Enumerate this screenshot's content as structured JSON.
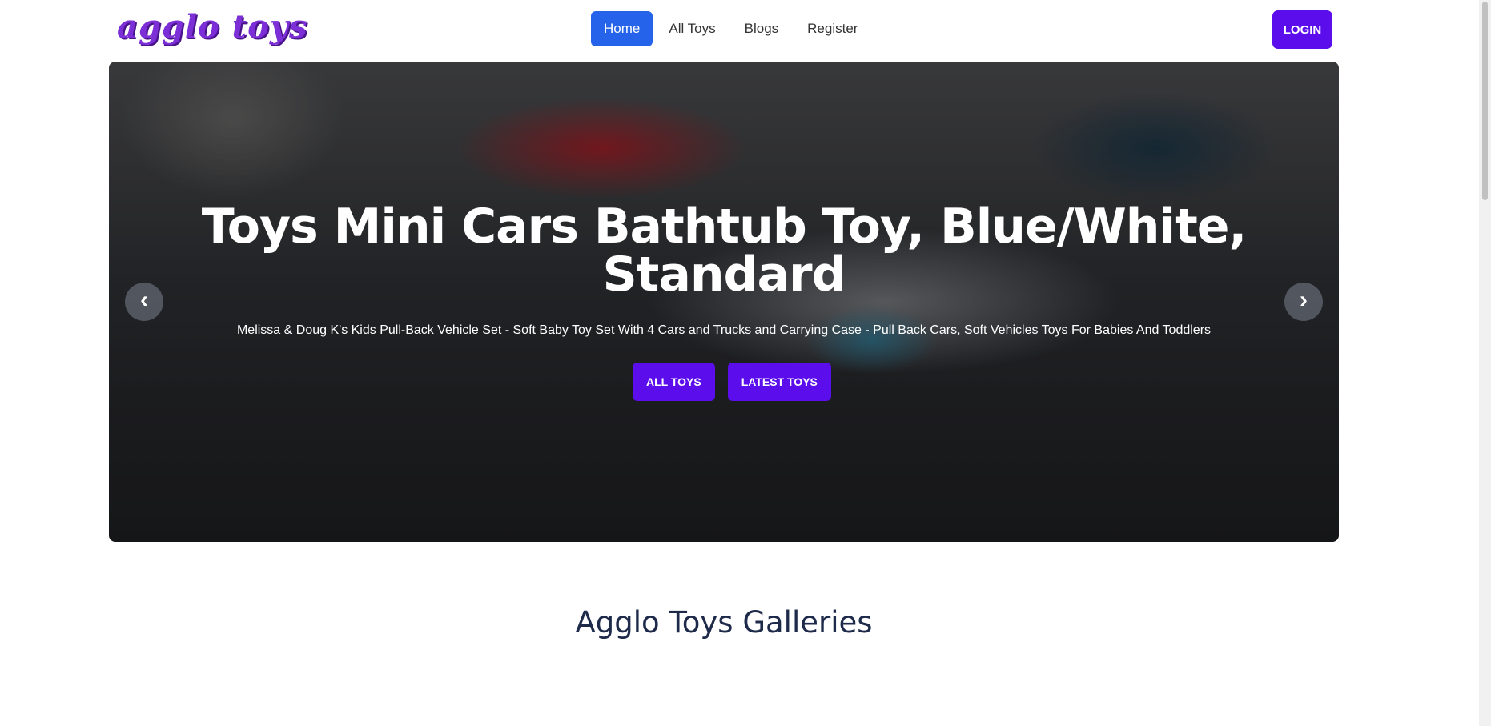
{
  "header": {
    "logo_text": "agglo toys",
    "nav": [
      {
        "label": "Home",
        "active": true
      },
      {
        "label": "All Toys",
        "active": false
      },
      {
        "label": "Blogs",
        "active": false
      },
      {
        "label": "Register",
        "active": false
      }
    ],
    "login_label": "LOGIN"
  },
  "hero": {
    "title": "Toys Mini Cars Bathtub Toy, Blue/White, Standard",
    "subtitle": "Melissa & Doug K's Kids Pull-Back Vehicle Set - Soft Baby Toy Set With 4 Cars and Trucks and Carrying Case - Pull Back Cars, Soft Vehicles Toys For Babies And Toddlers",
    "buttons": {
      "all_toys": "ALL TOYS",
      "latest_toys": "LATEST TOYS"
    },
    "prev_arrow": "‹",
    "next_arrow": "›"
  },
  "gallery": {
    "title": "Agglo Toys Galleries"
  },
  "colors": {
    "brand_purple": "#5b0eeb",
    "nav_active": "#2563eb",
    "heading_navy": "#1e2a4a"
  }
}
